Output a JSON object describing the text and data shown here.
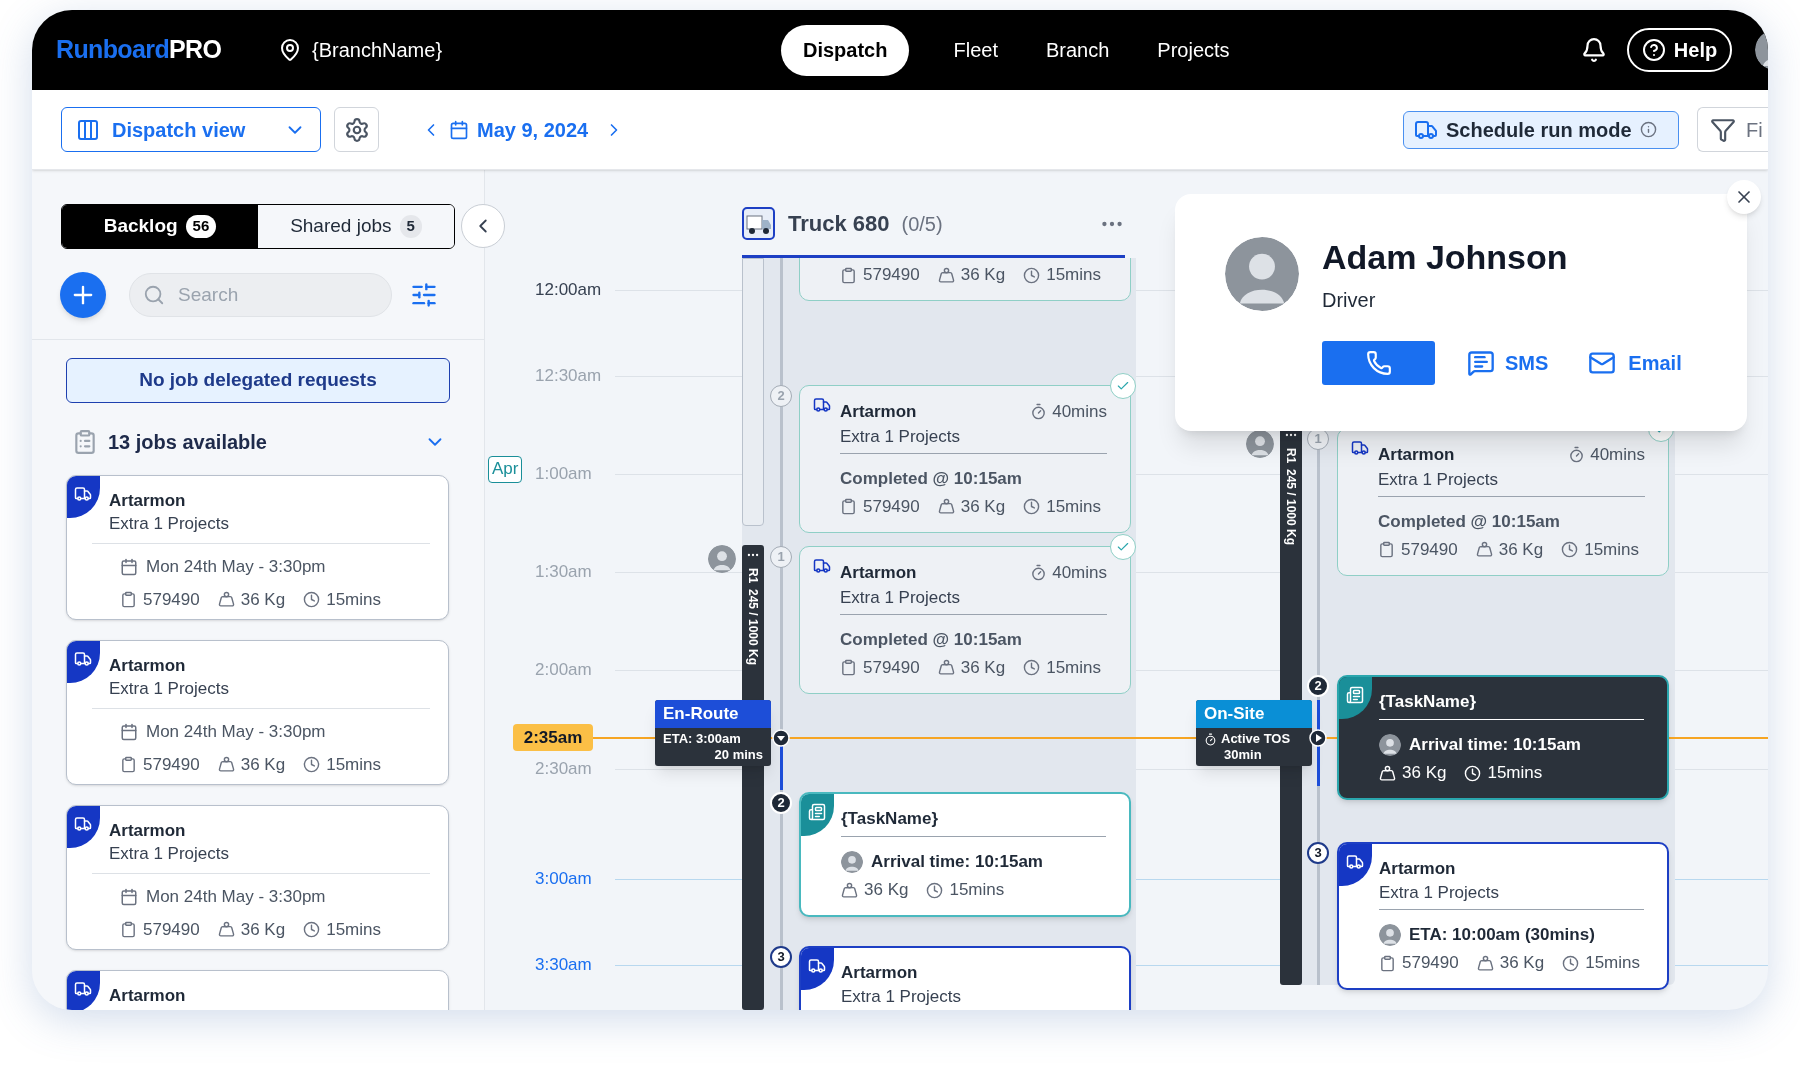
{
  "topbar": {
    "brand": "Runboard",
    "edition": "PRO",
    "branch": "{BranchName}",
    "help": "Help",
    "nav": [
      {
        "label": "Dispatch",
        "selected": true
      },
      {
        "label": "Fleet",
        "selected": false
      },
      {
        "label": "Branch",
        "selected": false
      },
      {
        "label": "Projects",
        "selected": false
      }
    ]
  },
  "toolbar": {
    "view": "Dispatch view",
    "date": "May 9, 2024",
    "schedule_mode": "Schedule run mode",
    "filter": "Fi"
  },
  "sidebar": {
    "tabs": [
      {
        "label": "Backlog",
        "count": "56",
        "selected": true
      },
      {
        "label": "Shared jobs",
        "count": "5",
        "selected": false
      }
    ],
    "search": {
      "placeholder": "Search"
    },
    "notice": "No job delegated requests",
    "jobs_header": "13 jobs available",
    "expanded": true,
    "jobs": [
      {
        "title": "Artarmon",
        "subtitle": "Extra 1 Projects",
        "date": "Mon 24th May - 3:30pm",
        "id": "579490",
        "weight": "36 Kg",
        "duration": "15mins"
      },
      {
        "title": "Artarmon",
        "subtitle": "Extra 1 Projects",
        "date": "Mon 24th May - 3:30pm",
        "id": "579490",
        "weight": "36 Kg",
        "duration": "15mins"
      },
      {
        "title": "Artarmon",
        "subtitle": "Extra 1 Projects",
        "date": "Mon 24th May - 3:30pm",
        "id": "579490",
        "weight": "36 Kg",
        "duration": "15mins"
      },
      {
        "title": "Artarmon"
      }
    ]
  },
  "timeline": {
    "month_tag": "Apr",
    "now": "2:35am",
    "times": [
      {
        "label": "12:00am",
        "kind": "emphasis"
      },
      {
        "label": "12:30am",
        "kind": "past"
      },
      {
        "label": "1:00am",
        "kind": "past"
      },
      {
        "label": "1:30am",
        "kind": "past"
      },
      {
        "label": "2:00am",
        "kind": "past"
      },
      {
        "label": "2:30am",
        "kind": "past"
      },
      {
        "label": "3:00am",
        "kind": "future"
      },
      {
        "label": "3:30am",
        "kind": "future"
      }
    ],
    "columns": [
      {
        "truck": "Truck 680",
        "count": "(0/5)",
        "route_label": "R1",
        "load": "245 / 1000 Kg",
        "status": {
          "kind": "en-route",
          "title": "En-Route",
          "lines": [
            "ETA: 3:00am",
            "20 mins"
          ]
        },
        "stops": [
          {
            "completed": true,
            "current": false,
            "in_progress": false,
            "id": "579490",
            "weight": "36 Kg",
            "duration": "15mins"
          },
          {
            "number": "2",
            "kind": "job",
            "completed": true,
            "current": false,
            "in_progress": false,
            "title": "Artarmon",
            "subtitle": "Extra 1 Projects",
            "estimate": "40mins",
            "note": "Completed @ 10:15am",
            "id": "579490",
            "weight": "36 Kg",
            "duration": "15mins"
          },
          {
            "number": "1",
            "kind": "job",
            "completed": true,
            "current": false,
            "in_progress": false,
            "title": "Artarmon",
            "subtitle": "Extra 1 Projects",
            "estimate": "40mins",
            "note": "Completed @ 10:15am",
            "id": "579490",
            "weight": "36 Kg",
            "duration": "15mins"
          },
          {
            "number": "2",
            "kind": "task",
            "completed": false,
            "current": true,
            "in_progress": false,
            "title": "{TaskName}",
            "note": "Arrival time: 10:15am",
            "weight": "36 Kg",
            "duration": "15mins"
          },
          {
            "number": "3",
            "kind": "job",
            "completed": false,
            "current": false,
            "in_progress": false,
            "title": "Artarmon",
            "subtitle": "Extra 1 Projects"
          }
        ]
      },
      {
        "route_label": "R1",
        "load": "245 / 1000 Kg",
        "status": {
          "kind": "on-site",
          "title": "On-Site",
          "lines": [
            "Active TOS",
            "30min"
          ]
        },
        "stops": [
          {
            "number": "1",
            "kind": "job",
            "completed": true,
            "current": false,
            "in_progress": false,
            "title": "Artarmon",
            "subtitle": "Extra 1 Projects",
            "estimate": "40mins",
            "note": "Completed @ 10:15am",
            "id": "579490",
            "weight": "36 Kg",
            "duration": "15mins"
          },
          {
            "number": "2",
            "kind": "task",
            "completed": false,
            "current": true,
            "in_progress": true,
            "title": "{TaskName}",
            "note": "Arrival time: 10:15am",
            "weight": "36 Kg",
            "duration": "15mins"
          },
          {
            "number": "3",
            "kind": "job",
            "completed": false,
            "current": false,
            "in_progress": false,
            "title": "Artarmon",
            "subtitle": "Extra 1 Projects",
            "note": "ETA: 10:00am (30mins)",
            "id": "579490",
            "weight": "36 Kg",
            "duration": "15mins"
          }
        ]
      }
    ]
  },
  "driver_card": {
    "name": "Adam Johnson",
    "role": "Driver",
    "actions": [
      {
        "kind": "call"
      },
      {
        "kind": "sms",
        "label": "SMS"
      },
      {
        "kind": "email",
        "label": "Email"
      }
    ]
  }
}
